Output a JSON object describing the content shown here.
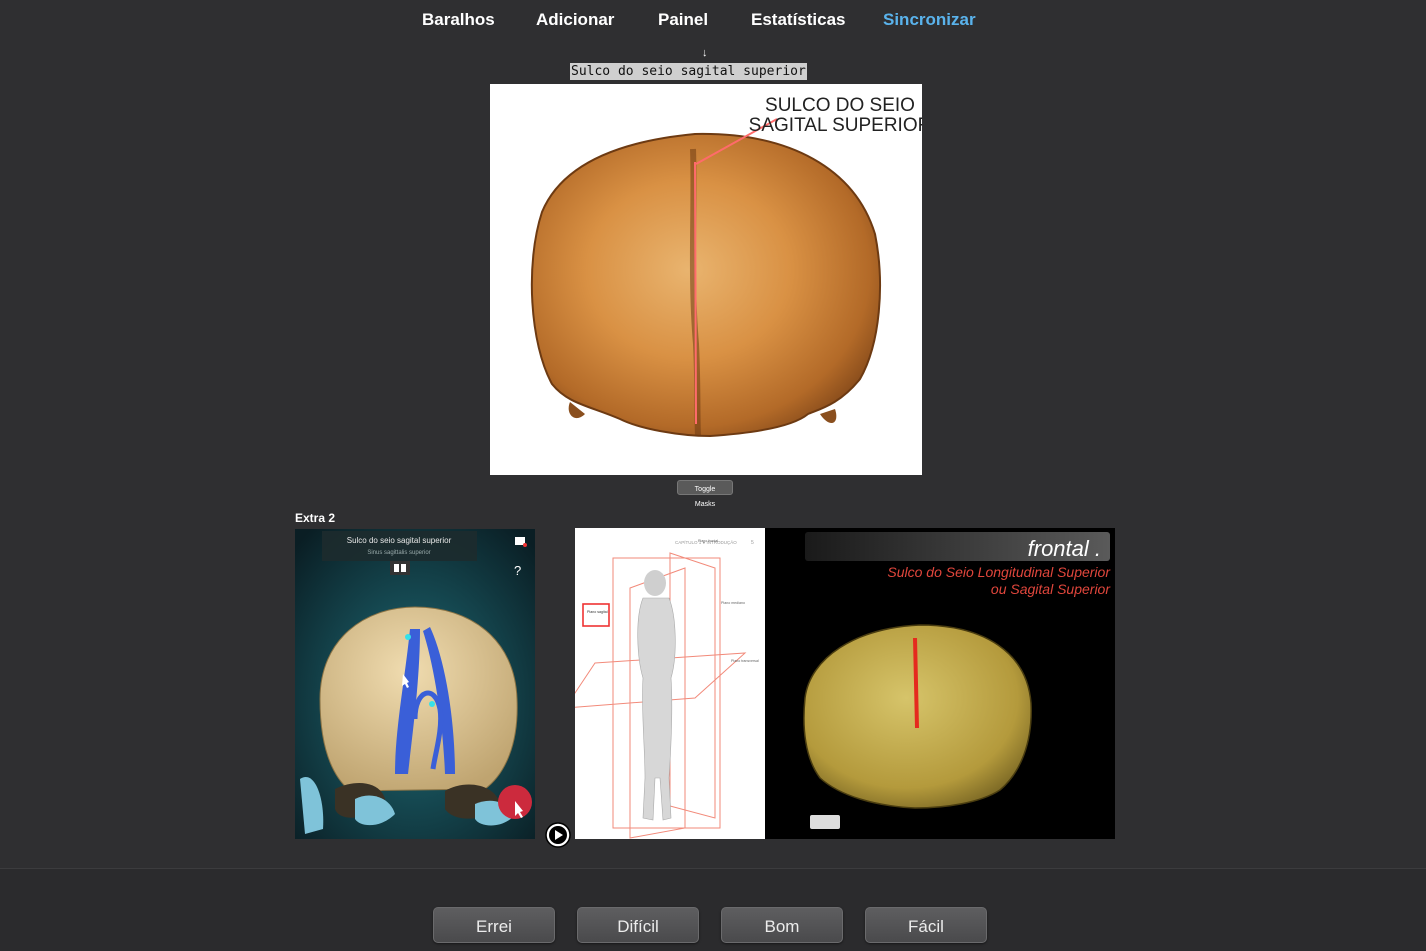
{
  "nav": {
    "items": [
      {
        "label": "Baralhos"
      },
      {
        "label": "Adicionar"
      },
      {
        "label": "Painel"
      },
      {
        "label": "Estatísticas"
      },
      {
        "label": "Sincronizar"
      }
    ],
    "active_color": "#5ab3ec"
  },
  "card": {
    "arrow": "↓",
    "front_text": "Sulco do seio sagital superior",
    "main_image_annotation": [
      "SULCO DO SEIO",
      "SAGITAL SUPERIOR"
    ],
    "toggle_label": "Toggle Masks"
  },
  "extra": {
    "label": "Extra 2",
    "app_title": "Sulco do seio sagital superior",
    "app_subtitle": "Sinus sagittalis superior",
    "diagram_header": "CAPÍTULO 1 ● INTRODUÇÃO",
    "diagram_page": "5",
    "diagram_labels": [
      "Plano frontal",
      "Plano sagital",
      "Plano mediano",
      "Plano transversal"
    ],
    "slide_title": "frontal .",
    "slide_caption_1": "Sulco do Seio Longitudinal Superior",
    "slide_caption_2": "ou Sagital Superior"
  },
  "answers": {
    "again": "Errei",
    "hard": "Difícil",
    "good": "Bom",
    "easy": "Fácil"
  },
  "colors": {
    "background": "#2f2f31",
    "annotation_line": "#ff6b6b",
    "slide_caption": "#e0463c"
  }
}
